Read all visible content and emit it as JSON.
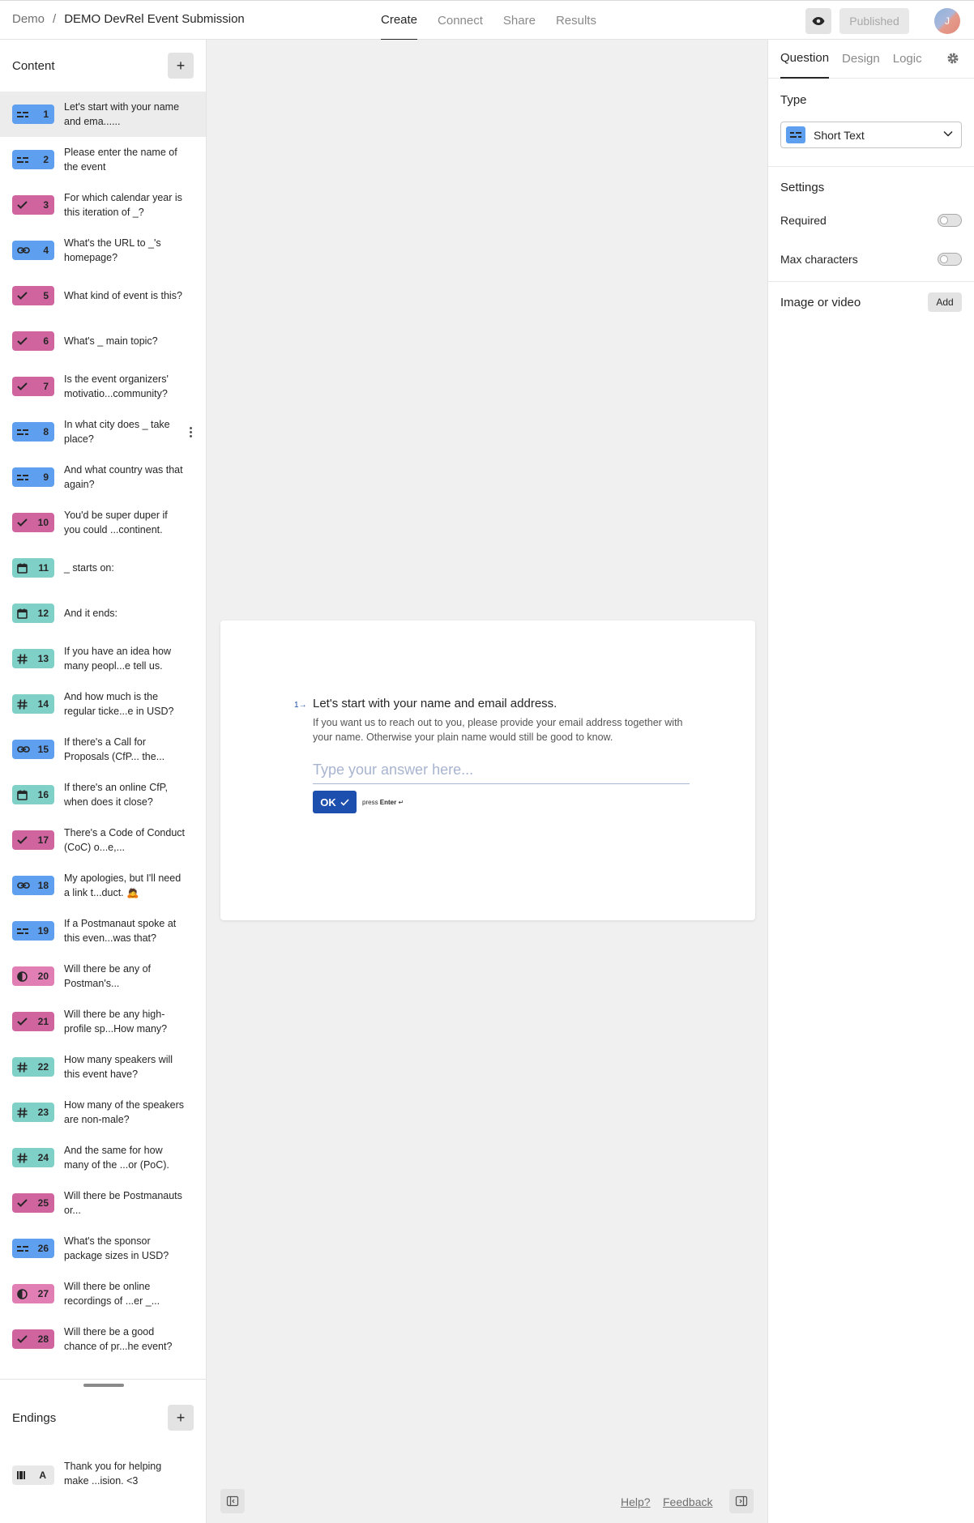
{
  "header": {
    "workspace": "Demo",
    "separator": "/",
    "form_title": "DEMO DevRel Event Submission",
    "tabs": [
      {
        "label": "Create",
        "active": true
      },
      {
        "label": "Connect",
        "active": false
      },
      {
        "label": "Share",
        "active": false
      },
      {
        "label": "Results",
        "active": false
      }
    ],
    "published_label": "Published",
    "avatar_initial": "J"
  },
  "sidebar": {
    "content_title": "Content",
    "questions": [
      {
        "num": "1",
        "type": "short-text",
        "color": "blue",
        "text": "Let's start with your name and ema......"
      },
      {
        "num": "2",
        "type": "short-text",
        "color": "blue",
        "text": "Please enter the name of the event"
      },
      {
        "num": "3",
        "type": "multiple-choice",
        "color": "pink",
        "text": "For which calendar year is this iteration of _?"
      },
      {
        "num": "4",
        "type": "website",
        "color": "blue",
        "text": "What's the URL to _'s homepage?"
      },
      {
        "num": "5",
        "type": "multiple-choice",
        "color": "pink",
        "text": "What kind of event is this?"
      },
      {
        "num": "6",
        "type": "multiple-choice",
        "color": "pink",
        "text": "What's _ main topic?"
      },
      {
        "num": "7",
        "type": "multiple-choice",
        "color": "pink",
        "text": "Is the event organizers' motivatio...community?"
      },
      {
        "num": "8",
        "type": "short-text",
        "color": "blue",
        "text": "In what city does _ take place?"
      },
      {
        "num": "9",
        "type": "short-text",
        "color": "blue",
        "text": "And what country was that again?"
      },
      {
        "num": "10",
        "type": "multiple-choice",
        "color": "pink",
        "text": "You'd be super duper if you could ...continent."
      },
      {
        "num": "11",
        "type": "date",
        "color": "teal",
        "text": "_ starts on:"
      },
      {
        "num": "12",
        "type": "date",
        "color": "teal",
        "text": "And it ends:"
      },
      {
        "num": "13",
        "type": "number",
        "color": "teal",
        "text": "If you have an idea how many peopl...e tell us."
      },
      {
        "num": "14",
        "type": "number",
        "color": "teal",
        "text": "And how much is the regular ticke...e in USD?"
      },
      {
        "num": "15",
        "type": "website",
        "color": "blue",
        "text": "If there's a Call for Proposals (CfP... the..."
      },
      {
        "num": "16",
        "type": "date",
        "color": "teal",
        "text": "If there's an online CfP, when does it close?"
      },
      {
        "num": "17",
        "type": "multiple-choice",
        "color": "pink",
        "text": "There's a Code of Conduct (CoC) o...e,..."
      },
      {
        "num": "18",
        "type": "website",
        "color": "blue",
        "text": "My apologies, but I'll need a link t...duct. 🙇"
      },
      {
        "num": "19",
        "type": "short-text",
        "color": "blue",
        "text": "If a Postmanaut spoke at this even...was that?"
      },
      {
        "num": "20",
        "type": "opinion",
        "color": "lpink",
        "text": "Will there be any of Postman's..."
      },
      {
        "num": "21",
        "type": "multiple-choice",
        "color": "pink",
        "text": "Will there be any high-profile sp...How many?"
      },
      {
        "num": "22",
        "type": "number",
        "color": "teal",
        "text": "How many speakers will this event have?"
      },
      {
        "num": "23",
        "type": "number",
        "color": "teal",
        "text": "How many of the speakers are non-male?"
      },
      {
        "num": "24",
        "type": "number",
        "color": "teal",
        "text": "And the same for how many of the ...or (PoC)."
      },
      {
        "num": "25",
        "type": "multiple-choice",
        "color": "pink",
        "text": "Will there be Postmanauts or..."
      },
      {
        "num": "26",
        "type": "short-text",
        "color": "blue",
        "text": "What's the sponsor package sizes in USD?"
      },
      {
        "num": "27",
        "type": "opinion",
        "color": "lpink",
        "text": "Will there be online recordings of ...er _..."
      },
      {
        "num": "28",
        "type": "multiple-choice",
        "color": "pink",
        "text": "Will there be a good chance of pr...he event?"
      }
    ],
    "endings_title": "Endings",
    "endings": [
      {
        "letter": "A",
        "text": "Thank you for helping make ...ision. <3"
      }
    ]
  },
  "canvas": {
    "question_number": "1",
    "question_title": "Let's start with your name and email address.",
    "question_description": "If you want us to reach out to you, please provide your email address together with your name. Otherwise your plain name would still be good to know.",
    "answer_placeholder": "Type your answer here...",
    "ok_label": "OK",
    "press_text": "press",
    "enter_text": "Enter",
    "enter_symbol": "↵",
    "help_link": "Help?",
    "feedback_link": "Feedback"
  },
  "rightpanel": {
    "tabs": [
      {
        "label": "Question",
        "active": true
      },
      {
        "label": "Design",
        "active": false
      },
      {
        "label": "Logic",
        "active": false
      }
    ],
    "type_label": "Type",
    "type_value": "Short Text",
    "settings_label": "Settings",
    "required_label": "Required",
    "required_on": false,
    "max_chars_label": "Max characters",
    "max_chars_on": false,
    "media_label": "Image or video",
    "add_label": "Add"
  },
  "colors": {
    "short_text": "#5f9ff0",
    "multiple_choice": "#d0649f",
    "date_number": "#7fd0c6",
    "opinion": "#e17eb4",
    "ok_button": "#1d4fae"
  }
}
